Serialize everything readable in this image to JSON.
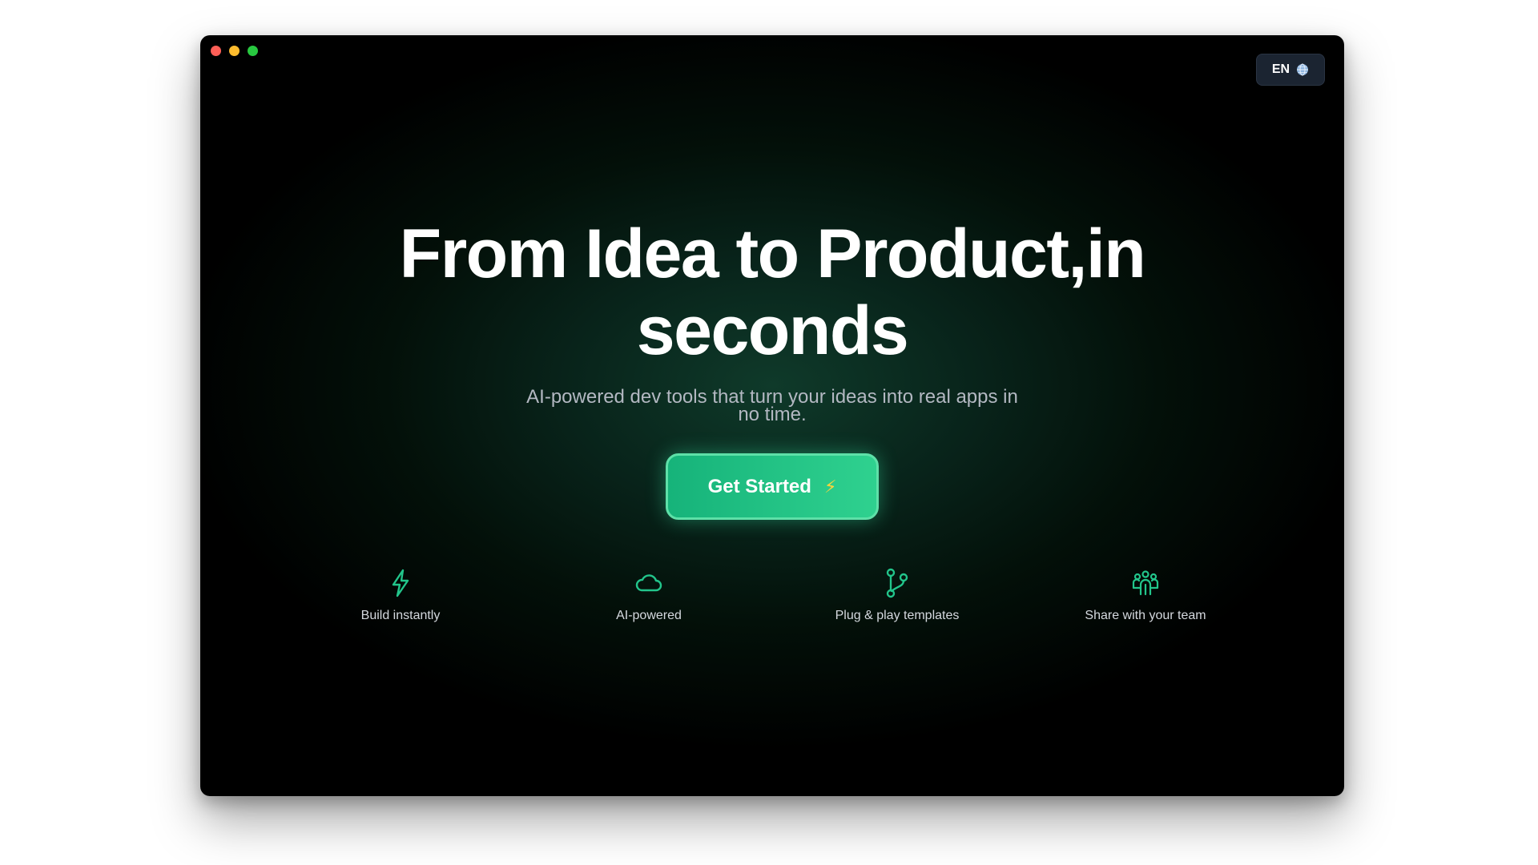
{
  "window": {
    "controls": [
      "close",
      "minimize",
      "zoom"
    ]
  },
  "language_button": {
    "label": "EN",
    "icon": "globe-icon"
  },
  "hero": {
    "title_line1": "From Idea to Product,in",
    "title_line2": "seconds",
    "subtitle_line1": "AI-powered dev tools that turn your ideas into real apps in",
    "subtitle_line2": "no time.",
    "cta_label": "Get Started",
    "cta_icon": "⚡"
  },
  "features": [
    {
      "label": "Build instantly",
      "icon": "lightning-icon"
    },
    {
      "label": "AI-powered",
      "icon": "cloud-icon"
    },
    {
      "label": "Plug & play templates",
      "icon": "git-branch-icon"
    },
    {
      "label": "Share with your team",
      "icon": "team-icon"
    }
  ],
  "colors": {
    "accent": "#22c58b",
    "accent_border": "#5ee0a8",
    "icon_green": "#22c58b",
    "background": "#000000"
  }
}
